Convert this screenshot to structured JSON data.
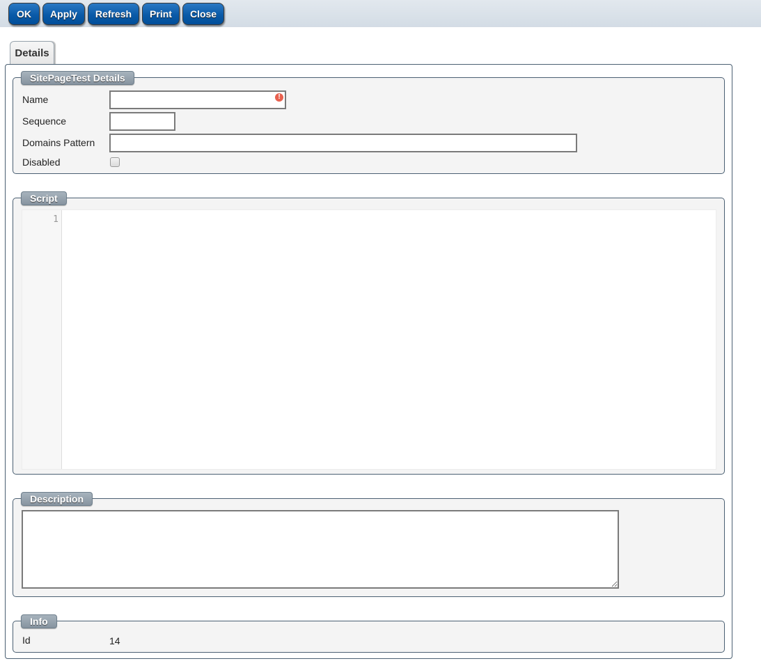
{
  "toolbar": {
    "buttons": [
      {
        "label": "OK"
      },
      {
        "label": "Apply"
      },
      {
        "label": "Refresh"
      },
      {
        "label": "Print"
      },
      {
        "label": "Close"
      }
    ]
  },
  "tabs": [
    {
      "label": "Details",
      "active": true
    }
  ],
  "details": {
    "legend": "SitePageTest Details",
    "fields": {
      "name": {
        "label": "Name",
        "value": "",
        "required_error": true
      },
      "sequence": {
        "label": "Sequence",
        "value": ""
      },
      "domains_pattern": {
        "label": "Domains Pattern",
        "value": ""
      },
      "disabled": {
        "label": "Disabled",
        "checked": false
      }
    },
    "error_icon": "!"
  },
  "script": {
    "legend": "Script",
    "line_numbers": [
      "1"
    ],
    "content": ""
  },
  "description": {
    "legend": "Description",
    "value": ""
  },
  "info": {
    "legend": "Info",
    "id_label": "Id",
    "id_value": "14"
  }
}
